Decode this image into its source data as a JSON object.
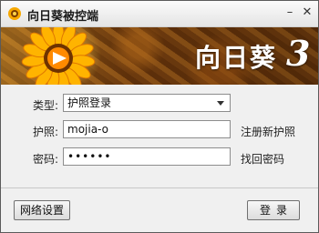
{
  "window": {
    "title": "向日葵被控端"
  },
  "banner": {
    "brand": "向日葵",
    "brand_number": "3"
  },
  "form": {
    "type_label": "类型:",
    "type_value": "护照登录",
    "passport_label": "护照:",
    "passport_value": "mojia-o",
    "password_label": "密码:",
    "password_value": "••••••",
    "register_link": "注册新护照",
    "recover_link": "找回密码"
  },
  "footer": {
    "network_button": "网络设置",
    "login_button": "登录"
  },
  "icons": [
    "sunflower-app-icon",
    "minimize-icon",
    "close-icon",
    "dropdown-arrow-icon",
    "sunflower-logo-icon"
  ]
}
